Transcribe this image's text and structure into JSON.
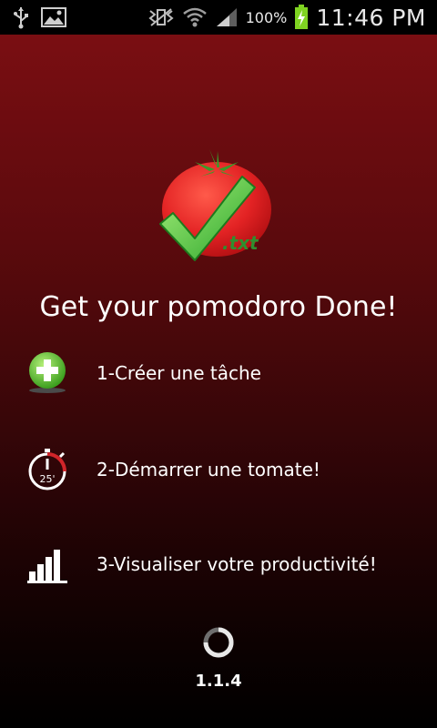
{
  "status_bar": {
    "icons_left": [
      "usb-icon",
      "image-icon"
    ],
    "icons_right": [
      "mute-vibrate-icon",
      "wifi-icon",
      "signal-icon",
      "battery-charging-icon"
    ],
    "battery": "100%",
    "time": "11:46 PM"
  },
  "app": {
    "logo_text": ".txt",
    "title": "Get your pomodoro Done!",
    "steps": [
      {
        "icon": "add-icon",
        "label": "1-Créer une tâche"
      },
      {
        "icon": "timer-icon",
        "timer_text": "25'",
        "label": "2-Démarrer une tomate!"
      },
      {
        "icon": "bar-chart-icon",
        "label": "3-Visualiser votre productivité!"
      }
    ],
    "version": "1.1.4"
  },
  "colors": {
    "background_top": "#7a0e12",
    "background_bottom": "#000000",
    "tomato": "#e32324",
    "check": "#3ec23e",
    "text": "#ffffff"
  }
}
